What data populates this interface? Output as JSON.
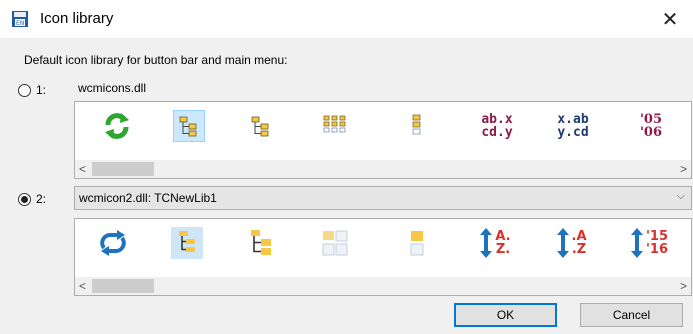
{
  "window": {
    "title": "Icon library",
    "close_glyph": "✕"
  },
  "subtitle": "Default icon library for button bar and main menu:",
  "option1": {
    "radio_label": "1:",
    "checked": false,
    "library": "wcmicons.dll",
    "icons": [
      {
        "name": "refresh-green-icon"
      },
      {
        "name": "tree-selected-icon",
        "selected": true
      },
      {
        "name": "tree-icon"
      },
      {
        "name": "grid-icon"
      },
      {
        "name": "vertical-list-icon"
      },
      {
        "name": "text-ab-x-icon",
        "line1": "ab.x",
        "line2": "cd.y"
      },
      {
        "name": "text-x-ab-icon",
        "line1": "x.ab",
        "line2": "y.cd"
      },
      {
        "name": "text-05-06-icon",
        "line1": "'05",
        "line2": "'06"
      }
    ]
  },
  "option2": {
    "radio_label": "2:",
    "checked": true,
    "library": "wcmicon2.dll: TCNewLib1",
    "icons": [
      {
        "name": "refresh-blue-icon"
      },
      {
        "name": "tree-highlight-icon"
      },
      {
        "name": "tree-folders-icon"
      },
      {
        "name": "folders-grid-icon"
      },
      {
        "name": "folder-file-icon"
      },
      {
        "name": "sort-az-icon",
        "line1": "A.",
        "line2": "Z."
      },
      {
        "name": "sort-az-alt-icon",
        "line1": ".A",
        "line2": ".Z"
      },
      {
        "name": "sort-15-16-icon",
        "line1": "'15",
        "line2": "'16"
      }
    ]
  },
  "scroll": {
    "left": "<",
    "right": ">"
  },
  "buttons": {
    "ok": "OK",
    "cancel": "Cancel"
  },
  "colors": {
    "accent": "#0078d7",
    "green": "#2ea52e",
    "blue": "#1e73be",
    "maroon": "#8b1a4a",
    "navy": "#1f3a6e",
    "folder": "#f6c744"
  }
}
